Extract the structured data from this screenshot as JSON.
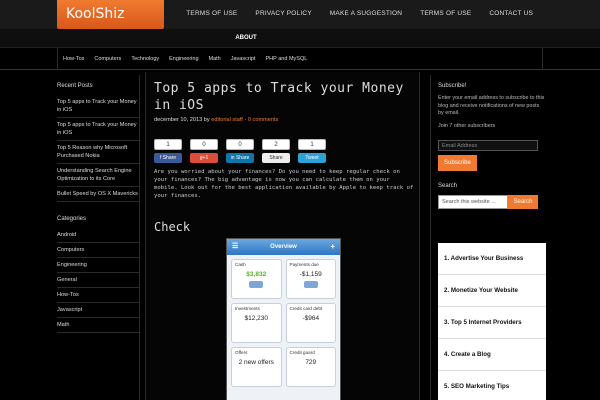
{
  "logo": "KoolShiz",
  "topnav": [
    "TERMS OF USE",
    "PRIVACY POLICY",
    "MAKE A SUGGESTION",
    "TERMS OF USE",
    "CONTACT US"
  ],
  "about": "ABOUT",
  "catnav": [
    "How-Tos",
    "Computers",
    "Technology",
    "Engineering",
    "Math",
    "Javascript",
    "PHP and MySQL"
  ],
  "left": {
    "recent_title": "Recent Posts",
    "recent": [
      "Top 5 apps to Track your Money in iOS",
      "Top 5 apps to Track your Money in iOS",
      "Top 5 Reason why Microsoft Purchased Nokia",
      "Understanding Search Engine Optimization to its Core",
      "Bullet Speed by OS X Mavericks"
    ],
    "categories_title": "Categories",
    "categories": [
      "Android",
      "Computers",
      "Engineering",
      "General",
      "How-Tos",
      "Javascript",
      "Math"
    ]
  },
  "post": {
    "title": "Top 5 apps to Track your Money in iOS",
    "date": "december 10, 2013",
    "by": "by",
    "author": "editorial staff",
    "sep": "·",
    "comments": "0 comments",
    "body": "Are you worried about your finances? Do you need to keep regular check on your finances? The big advantage is now you can calculate them on your mobile. Look out for the best application available by Apple to keep track of your finances.",
    "check": "Check",
    "share": [
      {
        "count": "1",
        "label": "f Share",
        "cls": "fb"
      },
      {
        "count": "0",
        "label": "g+1",
        "cls": "gp"
      },
      {
        "count": "0",
        "label": "in Share",
        "cls": "li"
      },
      {
        "count": "2",
        "label": "Share",
        "cls": "sh"
      },
      {
        "count": "1",
        "label": "Tweet",
        "cls": "tw"
      }
    ]
  },
  "phone": {
    "header": "Overview",
    "cards": [
      {
        "label": "Cash",
        "value": "$3,832",
        "green": true
      },
      {
        "label": "Payments due",
        "value": "-$1,159"
      },
      {
        "label": "Investments",
        "value": "$12,230"
      },
      {
        "label": "Credit card debt",
        "value": "-$964"
      },
      {
        "label": "Offers",
        "value": "2 new offers"
      },
      {
        "label": "Credit guard",
        "value": "729"
      }
    ]
  },
  "right": {
    "subscribe_title": "Subscribe!",
    "subscribe_text": "Enter your email address to subscribe to this blog and receive notifications of new posts by email.",
    "subscribers": "Join 7 other subscribers",
    "email_placeholder": "Email Address",
    "subscribe_button": "Subscribe",
    "search_title": "Search",
    "search_placeholder": "Search this website ...",
    "search_button": "Search",
    "list": [
      "1.  Advertise Your Business",
      "2.  Monetize Your Website",
      "3.  Top 5 Internet Providers",
      "4.  Create a Blog",
      "5.  SEO Marketing Tips"
    ]
  }
}
